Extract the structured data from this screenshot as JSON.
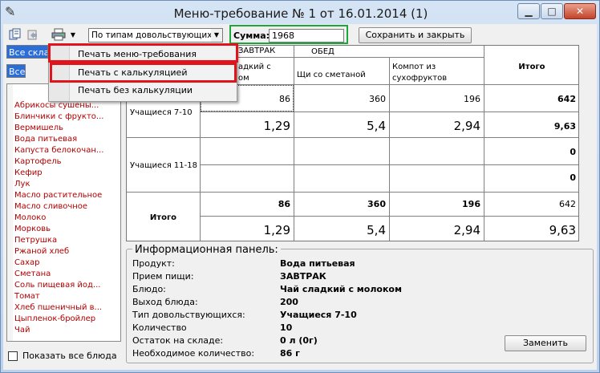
{
  "window": {
    "title": "Меню-требование № 1 от 16.01.2014 (1)",
    "min_glyph": "▁",
    "max_glyph": "□",
    "close_glyph": "✕",
    "icon_glyph": "✎"
  },
  "toolbar": {
    "icons": [
      "document-copy-icon",
      "undo-icon",
      "print-icon"
    ],
    "dropdown_arrow": "▼",
    "type_select_value": "По типам довольствующихся",
    "sum_label": "Сумма:",
    "sum_value": "1968",
    "save_close_label": "Сохранить и закрыть"
  },
  "filters": {
    "store_value": "Все склады",
    "all_value": "Все"
  },
  "products": [
    "Абрикосы сушены...",
    "Блинчики с фрукто...",
    "Вермишель",
    "Вода питьевая",
    "Капуста белокочан...",
    "Картофель",
    "Кефир",
    "Лук",
    "Масло растительное",
    "Масло сливочное",
    "Молоко",
    "Морковь",
    "Петрушка",
    "Ржаной хлеб",
    "Сахар",
    "Сметана",
    "Соль пищевая йод...",
    "Томат",
    "Хлеб пшеничный в...",
    "Цыпленок-бройлер",
    "Чай"
  ],
  "show_all_dishes_label": "Показать все блюда",
  "grid": {
    "meal_headers": [
      "ЗАВТРАК",
      "ОБЕД"
    ],
    "dish_headers": [
      "Чай сладкий с молоком",
      "Щи со сметаной",
      "Компот из сухофруктов"
    ],
    "dish_header_visible": [
      "адкий с",
      "ом"
    ],
    "compote_lines": [
      "Компот из",
      "сухофруктов"
    ],
    "total_header": "Итого",
    "rows": [
      {
        "label": "Учащиеся 7-10",
        "qty": [
          "86",
          "360",
          "196",
          "642"
        ],
        "cost": [
          "1,29",
          "5,4",
          "2,94",
          "9,63"
        ]
      },
      {
        "label": "Учащиеся 11-18",
        "qty": [
          "",
          "",
          "",
          "0"
        ],
        "cost": [
          "",
          "",
          "",
          "0"
        ]
      },
      {
        "label": "Итого",
        "qty": [
          "86",
          "360",
          "196",
          "642"
        ],
        "cost": [
          "1,29",
          "5,4",
          "2,94",
          "9,63"
        ]
      }
    ]
  },
  "info_panel": {
    "title": "Информационная панель:",
    "rows": [
      {
        "key": "Продукт:",
        "value": "Вода питьевая"
      },
      {
        "key": "Прием пищи:",
        "value": "ЗАВТРАК"
      },
      {
        "key": "Блюдо:",
        "value": "Чай сладкий с молоком"
      },
      {
        "key": "Выход блюда:",
        "value": "200"
      },
      {
        "key": "Тип довольствующихся:",
        "value": "Учащиеся 7-10"
      },
      {
        "key": "Количество",
        "value": "10"
      },
      {
        "key": "Остаток на складе:",
        "value": "0 л (0г)"
      },
      {
        "key": "Необходимое количество:",
        "value": "86 г"
      }
    ],
    "replace_label": "Заменить"
  },
  "print_menu": {
    "items": [
      "Печать меню-требования",
      "Печать с калькуляцией",
      "Печать без калькуляции"
    ]
  },
  "colors": {
    "highlight_red": "#e0141b",
    "highlight_green": "#1ba83a",
    "product_text": "#b00000",
    "selection_blue": "#2b6ed9"
  }
}
